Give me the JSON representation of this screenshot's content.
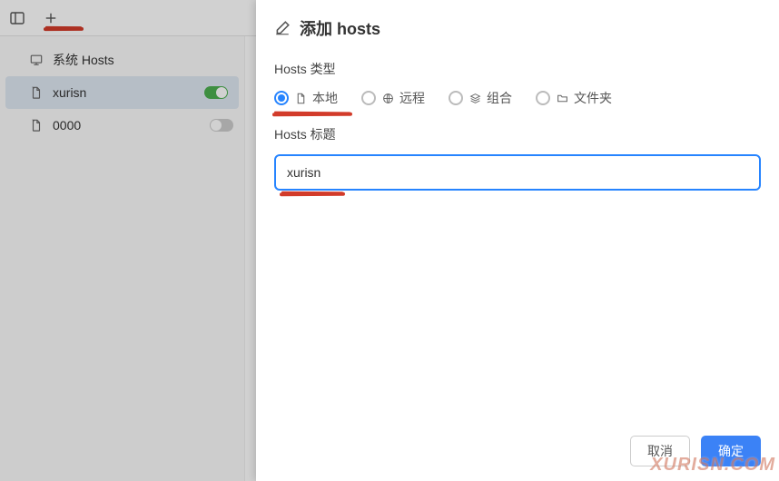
{
  "topbar": {
    "panel_icon_name": "panel-icon",
    "add_name": "add-tab"
  },
  "sidebar": {
    "items": [
      {
        "icon": "monitor",
        "label": "系统 Hosts",
        "active": false,
        "toggle": null
      },
      {
        "icon": "file",
        "label": "xurisn",
        "active": true,
        "toggle": true
      },
      {
        "icon": "file",
        "label": "0000",
        "active": false,
        "toggle": false
      }
    ]
  },
  "dialog": {
    "title": "添加 hosts",
    "type_label": "Hosts 类型",
    "options": [
      {
        "icon": "file",
        "label": "本地",
        "checked": true
      },
      {
        "icon": "globe",
        "label": "远程",
        "checked": false
      },
      {
        "icon": "layers",
        "label": "组合",
        "checked": false
      },
      {
        "icon": "folder",
        "label": "文件夹",
        "checked": false
      }
    ],
    "title_label": "Hosts 标题",
    "title_value": "xurisn",
    "cancel": "取消",
    "ok": "确定"
  },
  "watermark": "XURISN.COM"
}
